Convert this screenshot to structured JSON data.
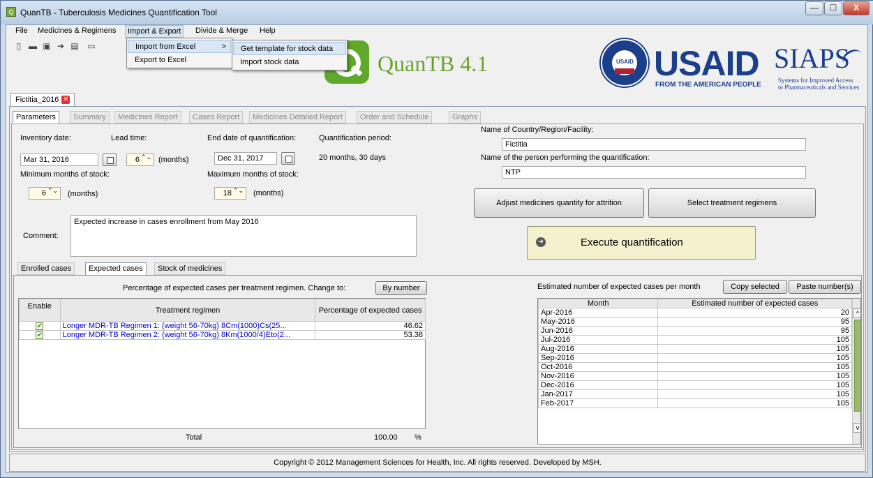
{
  "window": {
    "title": "QuanTB - Tuberculosis Medicines Quantification Tool",
    "app_icon_glyph": "Q",
    "controls": {
      "minimize": "—",
      "maximize": "☐",
      "close": "X"
    }
  },
  "menubar": {
    "items": [
      {
        "label": "File"
      },
      {
        "label": "Medicines & Regimens"
      },
      {
        "label": "Import & Export"
      },
      {
        "label": "Divide & Merge"
      },
      {
        "label": "Help"
      }
    ]
  },
  "import_menu": {
    "items": [
      {
        "label": "Import from Excel",
        "submenu_arrow": ">"
      },
      {
        "label": "Export to Excel"
      }
    ],
    "submenu": [
      {
        "label": "Get template for stock data"
      },
      {
        "label": "Import stock data"
      }
    ]
  },
  "toolbar": {
    "icons": [
      {
        "name": "new-file-icon",
        "glyph": "▯"
      },
      {
        "name": "open-folder-icon",
        "glyph": "▬"
      },
      {
        "name": "save-icon",
        "glyph": "▣"
      },
      {
        "name": "go-icon",
        "glyph": "➔"
      },
      {
        "name": "print-icon",
        "glyph": "▤"
      },
      {
        "name": "keyboard-icon",
        "glyph": "▭"
      }
    ]
  },
  "branding": {
    "app_name": "QuanTB 4.1",
    "usaid": "USAID",
    "usaid_sub": "FROM THE AMERICAN PEOPLE",
    "usaid_seal_text": "USAID",
    "siaps": "SIAPS",
    "siaps_sub_line1": "Systems for Improved Access",
    "siaps_sub_line2": "to Pharmaceuticals and Services"
  },
  "document_tab": {
    "label": "Fictitia_2016",
    "close_glyph": "✕"
  },
  "main_tabs": [
    {
      "label": "Parameters",
      "state": "active"
    },
    {
      "label": "Summary",
      "state": "disabled"
    },
    {
      "label": "Medicines Report",
      "state": "disabled"
    },
    {
      "label": "Cases Report",
      "state": "disabled"
    },
    {
      "label": "Medicines Detailed Report",
      "state": "disabled"
    },
    {
      "label": "Order and Schedule",
      "state": "disabled"
    },
    {
      "label": "Graphs",
      "state": "disabled"
    }
  ],
  "parameters": {
    "inventory_date_label": "Inventory date:",
    "inventory_date": "Mar 31, 2016",
    "lead_time_label": "Lead time:",
    "lead_time": "6",
    "lead_time_unit": "(months)",
    "end_date_label": "End date of quantification:",
    "end_date": "Dec 31, 2017",
    "period_label": "Quantification period:",
    "period_value": "20 months, 30 days",
    "min_stock_label": "Minimum months of stock:",
    "min_stock": "6",
    "min_stock_unit": "(months)",
    "max_stock_label": "Maximum months of stock:",
    "max_stock": "18",
    "max_stock_unit": "(months)",
    "comment_label": "Comment:",
    "comment": "Expected increase in cases enrollment from May 2016",
    "country_label": "Name of Country/Region/Facility:",
    "country": "Fictitia",
    "person_label": "Name of the person performing the quantification:",
    "person": "NTP",
    "adjust_button": "Adjust medicines quantity for attrition",
    "select_regimens_button": "Select treatment regimens",
    "execute_button": "Execute quantification",
    "spin_arrows_glyph": "⌃⌄",
    "execute_icon_glyph": "➔"
  },
  "sub_tabs": [
    {
      "label": "Enrolled cases",
      "state": "enabled"
    },
    {
      "label": "Expected cases",
      "state": "active"
    },
    {
      "label": "Stock of medicines",
      "state": "enabled"
    }
  ],
  "expected_cases": {
    "caption": "Percentage of expected cases per treatment regimen. Change to:",
    "by_number_button": "By number",
    "columns": [
      "Enable",
      "Treatment regimen",
      "Percentage of expected cases"
    ],
    "rows": [
      {
        "enabled": true,
        "regimen": "Longer MDR-TB Regimen 1: (weight 56-70kg)  8Cm(1000)Cs(25...",
        "percentage": "46.62"
      },
      {
        "enabled": true,
        "regimen": "Longer MDR-TB Regimen 2: (weight 56-70kg)  8Km(1000/4)Eto(2...",
        "percentage": "53.38"
      }
    ],
    "checkbox_glyph": "✔",
    "total_label": "Total",
    "total_value": "100.00",
    "total_unit": "%"
  },
  "monthly_cases": {
    "caption": "Estimated number of expected cases per month",
    "copy_button": "Copy selected",
    "paste_button": "Paste number(s)",
    "columns": [
      "Month",
      "Estimated number of expected cases"
    ],
    "rows": [
      {
        "month": "Apr-2016",
        "value": "20"
      },
      {
        "month": "May-2016",
        "value": "95"
      },
      {
        "month": "Jun-2016",
        "value": "95"
      },
      {
        "month": "Jul-2016",
        "value": "105"
      },
      {
        "month": "Aug-2016",
        "value": "105"
      },
      {
        "month": "Sep-2016",
        "value": "105"
      },
      {
        "month": "Oct-2016",
        "value": "105"
      },
      {
        "month": "Nov-2016",
        "value": "105"
      },
      {
        "month": "Dec-2016",
        "value": "105"
      },
      {
        "month": "Jan-2017",
        "value": "105"
      },
      {
        "month": "Feb-2017",
        "value": "105"
      }
    ],
    "scroll_up_glyph": "^",
    "scroll_down_glyph": "v"
  },
  "footer": {
    "text": "Copyright © 2012 Management Sciences for Health, Inc. All rights reserved. Developed by MSH."
  }
}
